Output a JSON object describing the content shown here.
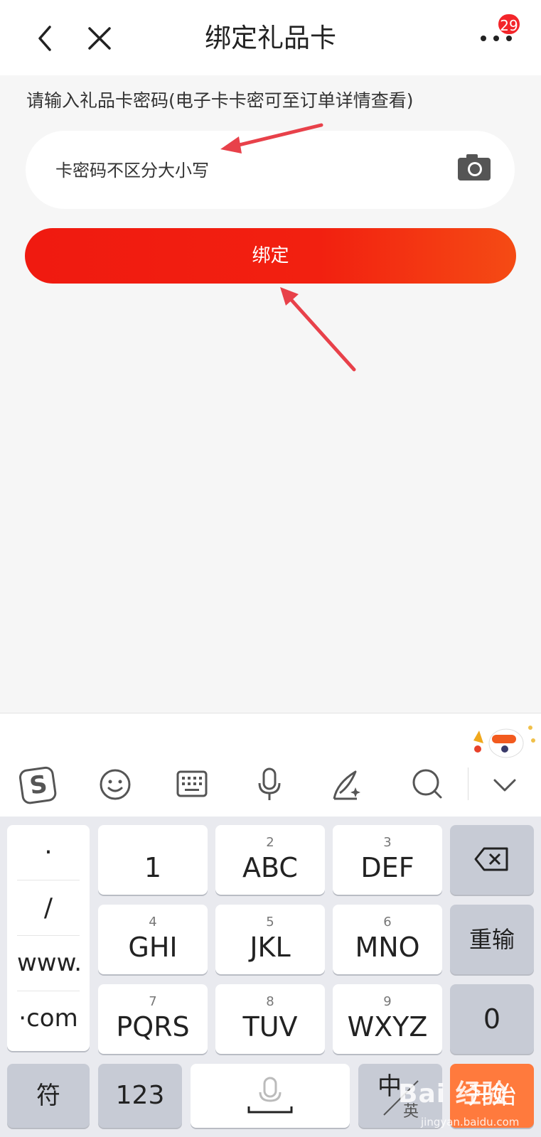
{
  "header": {
    "title": "绑定礼品卡",
    "badge_count": "29"
  },
  "form": {
    "hint": "请输入礼品卡密码(电子卡卡密可至订单详情查看)",
    "input_placeholder": "卡密码不区分大小写",
    "bind_label": "绑定"
  },
  "keyboard": {
    "toolbar": [
      "sogou-logo-icon",
      "emoji-icon",
      "keyboard-icon",
      "microphone-icon",
      "handwriting-icon",
      "search-icon",
      "chevron-down-icon"
    ],
    "symbols": [
      "·",
      "/",
      "www.",
      "·com"
    ],
    "keys": [
      {
        "num": "",
        "label": "1"
      },
      {
        "num": "2",
        "label": "ABC"
      },
      {
        "num": "3",
        "label": "DEF"
      },
      {
        "num": "4",
        "label": "GHI"
      },
      {
        "num": "5",
        "label": "JKL"
      },
      {
        "num": "6",
        "label": "MNO"
      },
      {
        "num": "7",
        "label": "PQRS"
      },
      {
        "num": "8",
        "label": "TUV"
      },
      {
        "num": "9",
        "label": "WXYZ"
      }
    ],
    "reenter_label": "重输",
    "zero_label": "0",
    "symbol_key_label": "符",
    "num_key_label": "123",
    "lang_main": "中",
    "lang_sub": "英",
    "go_label": "开始"
  },
  "watermark": {
    "main": "Bai 经验",
    "sub": "jingyan.baidu.com"
  },
  "colors": {
    "accent_red": "#f01a10",
    "badge_red": "#f3252a",
    "go_orange": "#ff7a3d",
    "annotation_arrow": "#e8414a"
  }
}
